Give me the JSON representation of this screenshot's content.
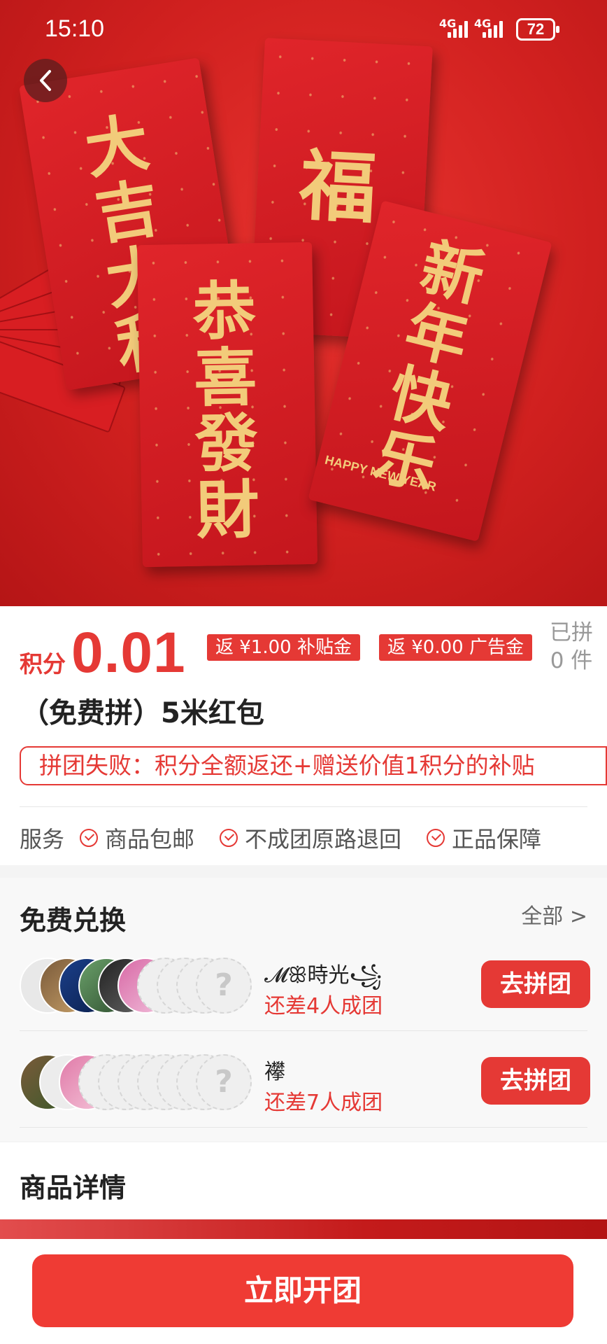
{
  "status_bar": {
    "time": "15:10",
    "signal_1": "4G",
    "signal_2": "4G",
    "battery": "72"
  },
  "hero": {
    "envelope_texts": [
      "大吉大利",
      "福",
      "恭喜發財",
      "新年快乐"
    ],
    "envelope_subtext": "HAPPY NEW YEAR",
    "icons": [
      "back-arrow-icon"
    ]
  },
  "product": {
    "price_prefix": "积分",
    "price_value": "0.01",
    "tags": [
      "返 ¥1.00 补贴金",
      "返 ¥0.00 广告金"
    ],
    "joined_label": "已拼",
    "joined_count": "0 件",
    "title": "（免费拼）5米红包",
    "fail_note": "拼团失败：积分全额返还+赠送价值1积分的补贴",
    "services_label": "服务",
    "services": [
      "商品包邮",
      "不成团原路退回",
      "正品保障"
    ]
  },
  "exchange": {
    "title": "免费兑换",
    "see_all": "全部 >",
    "groups": [
      {
        "name": "𝓜ꕥ時光꧁",
        "need": "还差4人成团",
        "button": "去拼团"
      },
      {
        "name": "襻",
        "need": "还差7人成团",
        "button": "去拼团"
      }
    ]
  },
  "details": {
    "title": "商品详情"
  },
  "bottom": {
    "action": "立即开团"
  },
  "colors": {
    "accent": "#e53935",
    "button": "#ef3b34",
    "hero_red": "#d0201f",
    "gold": "#f2cb7a"
  }
}
